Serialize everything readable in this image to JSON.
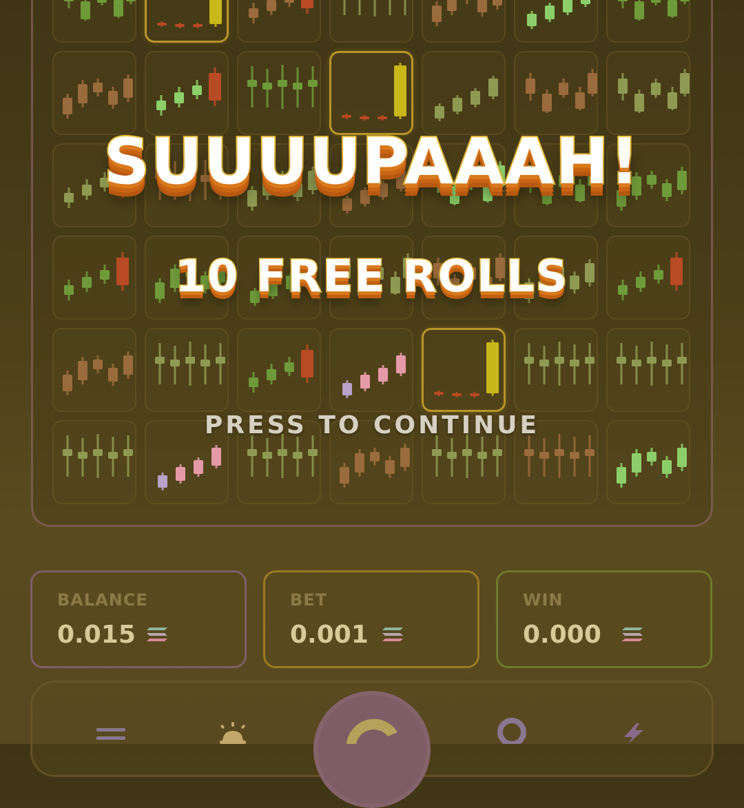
{
  "overlay": {
    "headline": "SUUUUPAAAH!",
    "subtitle": "10 FREE ROLLS",
    "continue_prompt": "PRESS TO CONTINUE"
  },
  "reels": {
    "columns": 7,
    "rows": 6,
    "highlighted_cells": [
      [
        1,
        0
      ],
      [
        3,
        1
      ],
      [
        4,
        4
      ]
    ],
    "colors": {
      "red": "#b84a24",
      "green": "#6f9a3a",
      "bright_green": "#8ccf6a",
      "tan": "#9a6b3c",
      "pink": "#e59aa8",
      "lavender": "#b8a2c8",
      "yellow": "#c8b81a",
      "olive": "#8e9a52",
      "highlight_border": "#b89528"
    }
  },
  "stats": {
    "balance": {
      "label": "BALANCE",
      "value": "0.015",
      "icon": "solana-icon",
      "border": "#7e5f68"
    },
    "bet": {
      "label": "BET",
      "value": "0.001",
      "icon": "solana-icon",
      "border": "#9a7a24"
    },
    "win": {
      "label": "WIN",
      "value": "0.000",
      "icon": "solana-icon",
      "border": "#6d7a2a"
    }
  },
  "controls": {
    "menu": {
      "icon": "menu-icon"
    },
    "autoplay": {
      "icon": "bell-icon"
    },
    "spin": {
      "icon": "spin-icon",
      "color": "#7d5e66"
    },
    "stop": {
      "icon": "stop-icon"
    },
    "turbo": {
      "icon": "lightning-icon"
    }
  }
}
